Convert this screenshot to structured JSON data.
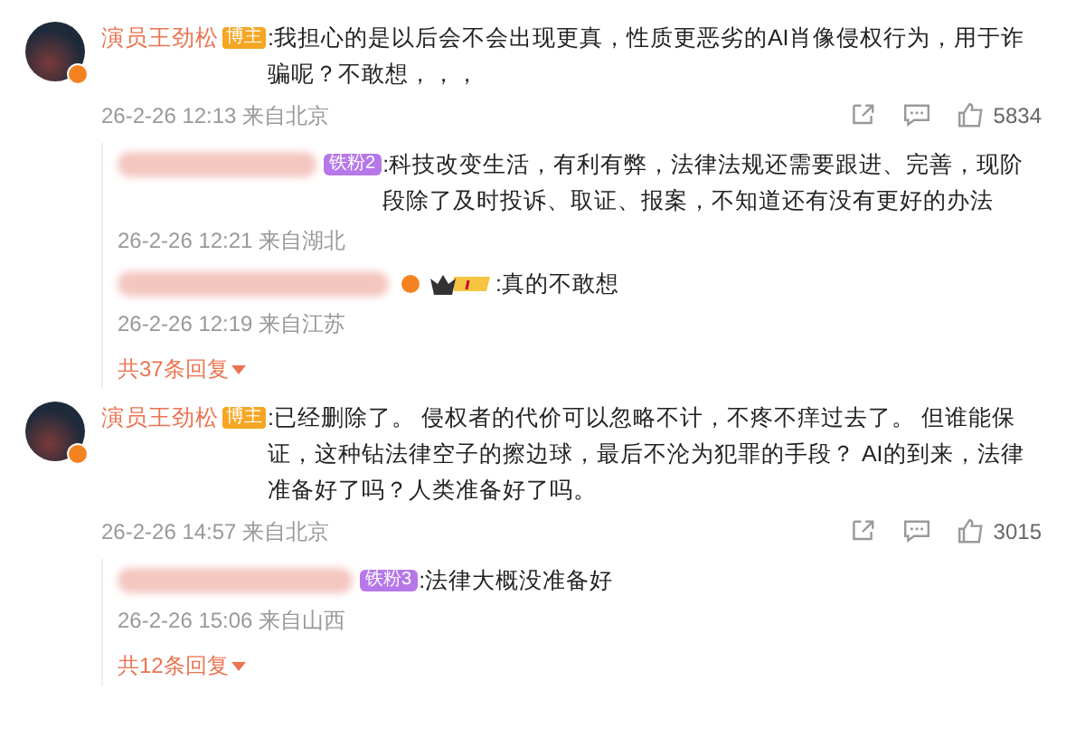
{
  "comments": [
    {
      "author": "演员王劲松",
      "verified": true,
      "badge": "博主",
      "text": ":我担心的是以后会不会出现更真，性质更恶劣的AI肖像侵权行为，用于诈骗呢？不敢想，，，",
      "meta": "26-2-26 12:13 来自北京",
      "likes": "5834",
      "replies": [
        {
          "badge": {
            "kind": "fan",
            "label": "铁粉2"
          },
          "text": ":科技改变生活，有利有弊，法律法规还需要跟进、完善，现阶段除了及时投诉、取证、报案，不知道还有没有更好的办法",
          "meta": "26-2-26 12:21 来自湖北"
        },
        {
          "badge": {
            "kind": "crown"
          },
          "verified": true,
          "text": ":真的不敢想",
          "meta": "26-2-26 12:19 来自江苏"
        }
      ],
      "more": "共37条回复"
    },
    {
      "author": "演员王劲松",
      "verified": true,
      "badge": "博主",
      "text": ":已经删除了。 侵权者的代价可以忽略不计，不疼不痒过去了。 但谁能保证，这种钻法律空子的擦边球，最后不沦为犯罪的手段？ AI的到来，法律准备好了吗？人类准备好了吗。",
      "meta": "26-2-26 14:57 来自北京",
      "likes": "3015",
      "replies": [
        {
          "badge": {
            "kind": "fan",
            "label": "铁粉3"
          },
          "text": ":法律大概没准备好",
          "meta": "26-2-26 15:06 来自山西"
        }
      ],
      "more": "共12条回复"
    }
  ]
}
